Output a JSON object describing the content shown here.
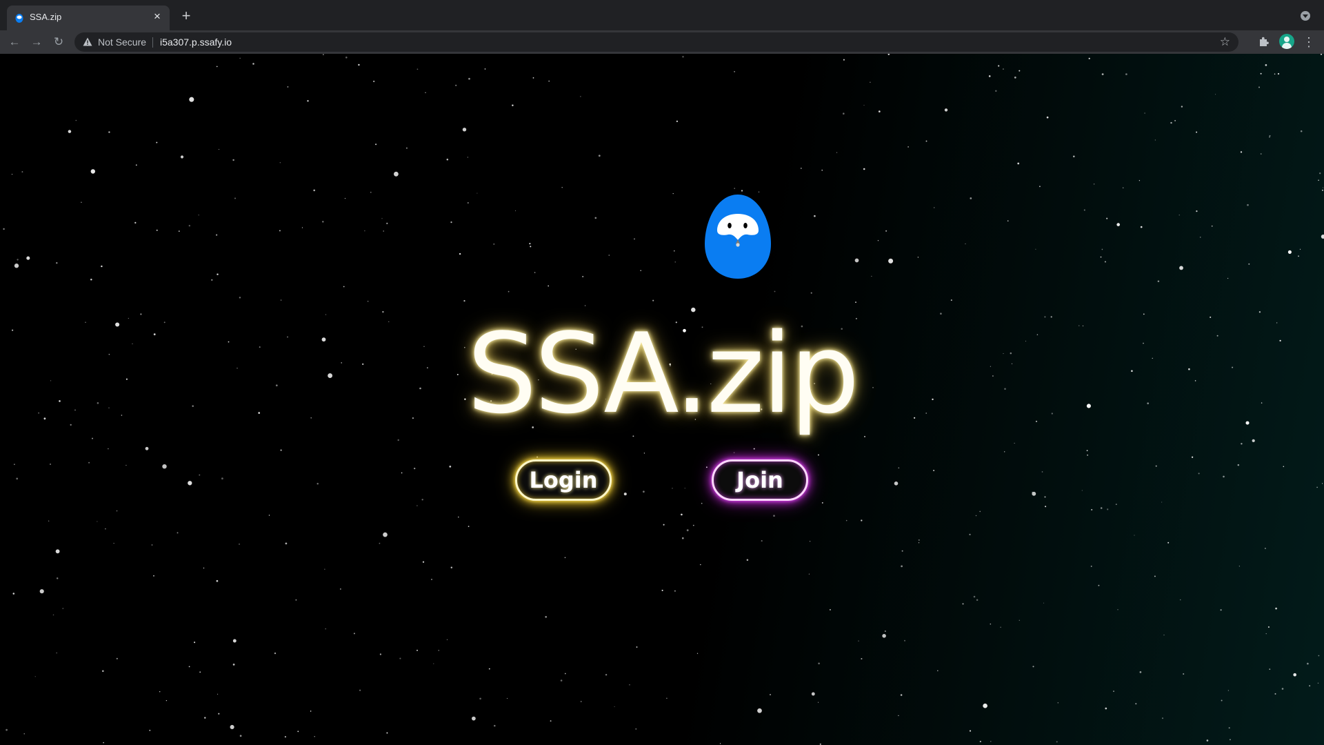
{
  "browser": {
    "tab": {
      "title": "SSA.zip",
      "close_glyph": "×",
      "favicon": "ssafy-mascot-icon"
    },
    "new_tab_glyph": "+",
    "nav": {
      "back_glyph": "←",
      "forward_glyph": "→",
      "reload_glyph": "↻"
    },
    "address": {
      "security_label": "Not Secure",
      "url": "i5a307.p.ssafy.io"
    },
    "star_glyph": "☆",
    "menu_glyph": "⋮"
  },
  "page": {
    "title": "SSA.zip",
    "buttons": {
      "login": "Login",
      "join": "Join"
    },
    "colors": {
      "mascot": "#0a7df2",
      "login_glow": "#ffd52e",
      "join_glow": "#c02ad8",
      "title_glow": "#ffe680"
    }
  }
}
